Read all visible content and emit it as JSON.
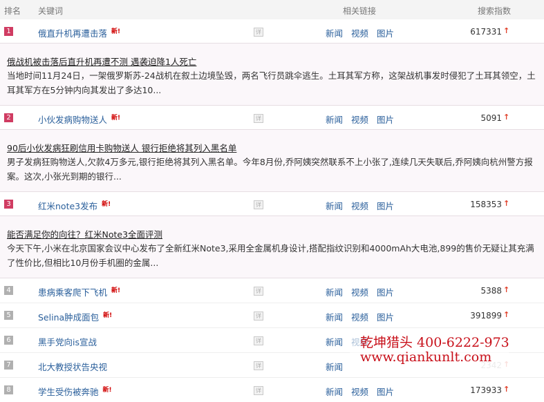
{
  "header": {
    "rank": "排名",
    "keyword": "关键词",
    "links": "相关链接",
    "index": "搜索指数"
  },
  "detail_label": "详",
  "new_label": "新!",
  "link_labels": {
    "news": "新闻",
    "video": "视频",
    "image": "图片"
  },
  "rows": [
    {
      "rank": "1",
      "keyword": "俄直升机再遭击落",
      "count": "617331",
      "expand": {
        "title": "俄战机被击落后直升机再遭不测 遇袭迫降1人死亡",
        "summary": "当地时间11月24日，一架俄罗斯苏-24战机在叙土边境坠毁，两名飞行员跳伞逃生。土耳其军方称，这架战机事发时侵犯了土耳其领空，土耳其军方在5分钟内向其发出了多达10..."
      }
    },
    {
      "rank": "2",
      "keyword": "小伙发病购物送人",
      "count": "5091",
      "expand": {
        "title": "90后小伙发病狂刷信用卡购物送人 银行拒绝将其列入黑名单",
        "summary": "男子发病狂购物送人,欠款4万多元,银行拒绝将其列入黑名单。今年8月份,乔阿姨突然联系不上小张了,连续几天失联后,乔阿姨向杭州警方报案。这次,小张光到期的银行..."
      }
    },
    {
      "rank": "3",
      "keyword": "红米note3发布",
      "count": "158353",
      "expand": {
        "title": "能否满足你的向往？红米Note3全面评测",
        "summary": "今天下午,小米在北京国家会议中心发布了全新红米Note3,采用全金属机身设计,搭配指纹识别和4000mAh大电池,899的售价无疑让其充满了性价比,但相比10月份手机圈的金属..."
      }
    },
    {
      "rank": "4",
      "keyword": "患病乘客爬下飞机",
      "count": "5388"
    },
    {
      "rank": "5",
      "keyword": "Selina肿成面包",
      "count": "391899"
    },
    {
      "rank": "6",
      "keyword": "黑手党向is宣战",
      "count": ""
    },
    {
      "rank": "7",
      "keyword": "北大教授状告央视",
      "count": "2342"
    },
    {
      "rank": "8",
      "keyword": "学生受伤被奔驰",
      "count": "173933"
    }
  ],
  "watermark": {
    "line1": "乾坤猎头  400-6222-973",
    "line2": "www.qiankunlt.com"
  }
}
